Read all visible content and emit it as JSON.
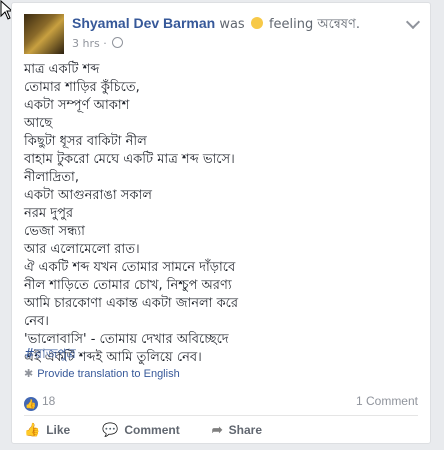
{
  "header": {
    "author": "Shyamal Dev Barman",
    "was": "was",
    "feeling": "feeling অন্বেষণ.",
    "time": "3 hrs ·"
  },
  "post": {
    "lines": [
      "মাত্র একটি শব্দ",
      "তোমার শাড়ির কুঁচিতে,",
      "একটা সম্পূর্ণ আকাশ",
      "আছে",
      "কিছুটা ধূসর বাকিটা নীল",
      "বাহাম টুকরো মেঘে একটি মাত্র শব্দ ভাসে।",
      "নীলাদ্রিতা,",
      "একটা আগুনরাঙা সকাল",
      "নরম দুপুর",
      "ভেজা সন্ধ্যা",
      "আর এলোমেলো রাত।",
      "ঐ একটি শব্দ যখন তোমার সামনে দাঁড়াবে",
      "নীল শাড়িতে তোমার চোখ, নিশ্চুপ অরণ্য",
      "আমি চারকোণা একান্ত একটা জানলা করে",
      "নেব।",
      "'ভালোবাসি' - তোমায় দেখার অবিচ্ছেদে",
      "এই একটি শব্দই আমি তুলিয়ে নেব।"
    ],
    "hashtag": "#রাজপুত্র",
    "translate": "Provide translation to English"
  },
  "stats": {
    "likes": "18",
    "comments": "1 Comment"
  },
  "actions": {
    "like": "Like",
    "comment": "Comment",
    "share": "Share"
  }
}
